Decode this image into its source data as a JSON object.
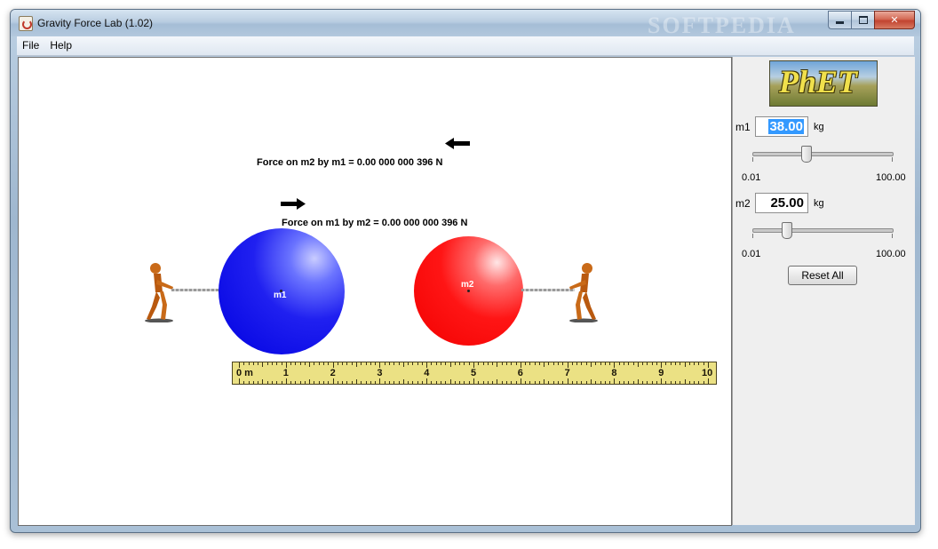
{
  "window": {
    "title": "Gravity Force Lab (1.02)",
    "watermark": "SOFTPEDIA"
  },
  "menu": {
    "items": [
      "File",
      "Help"
    ]
  },
  "canvas": {
    "force_on_m2": "Force on m2 by m1 = 0.00 000 000 396  N",
    "force_on_m1": "Force on m1 by m2 = 0.00 000 000 396  N",
    "m1_label": "m1",
    "m2_label": "m2",
    "ruler_labels": [
      "0 m",
      "1",
      "2",
      "3",
      "4",
      "5",
      "6",
      "7",
      "8",
      "9",
      "10"
    ],
    "colors": {
      "mass1": "#0000e0",
      "mass2": "#f20000",
      "ruler": "#ebe184",
      "figure": "#c96a18"
    }
  },
  "panel": {
    "logo_text": "PhET",
    "m1": {
      "label": "m1",
      "value_selected": "38.00",
      "unit": "kg",
      "min_label": "0.01",
      "max_label": "100.00",
      "value": 38.0
    },
    "m2": {
      "label": "m2",
      "value": "25.00",
      "unit": "kg",
      "min_label": "0.01",
      "max_label": "100.00",
      "numeric": 25.0
    },
    "reset_label": "Reset All"
  }
}
